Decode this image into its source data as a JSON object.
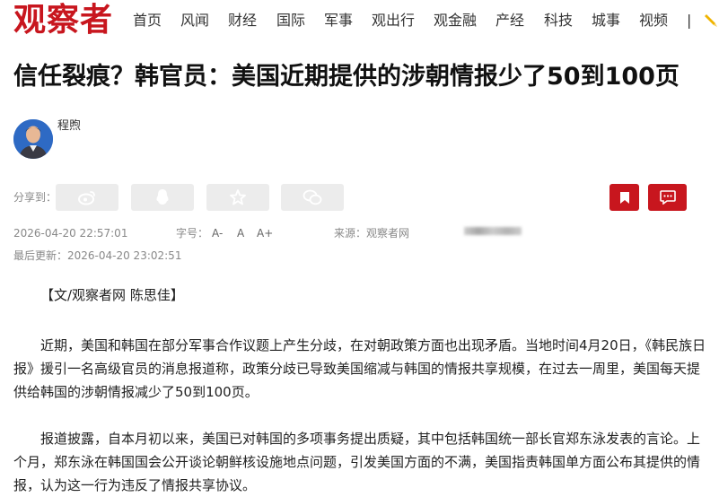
{
  "header": {
    "logo_text": "观察者",
    "nav": [
      "首页",
      "风闻",
      "财经",
      "国际",
      "军事",
      "观出行",
      "观金融",
      "产经",
      "科技",
      "城事",
      "视频"
    ],
    "separator": "|",
    "brand_color": "#c8161e"
  },
  "article": {
    "title": "信任裂痕？韩官员：美国近期提供的涉朝情报少了50到100页",
    "author": "程煦",
    "share_label": "分享到：",
    "share_icons": [
      "weibo-icon",
      "qq-icon",
      "star-icon",
      "wechat-icon"
    ],
    "publish_time": "2026-04-20 22:57:01",
    "font_size_label": "字号：",
    "font_sizes": [
      "A-",
      "A",
      "A+"
    ],
    "source_label": "来源：观察者网",
    "updated": "最后更新：2026-04-20 23:02:51",
    "byline": "【文/观察者网 陈思佳】",
    "paragraphs": [
      "近期，美国和韩国在部分军事合作议题上产生分歧，在对朝政策方面也出现矛盾。当地时间4月20日，《韩民族日报》援引一名高级官员的消息报道称，政策分歧已导致美国缩减与韩国的情报共享规模，在过去一周里，美国每天提供给韩国的涉朝情报减少了50到100页。",
      "报道披露，自本月初以来，美国已对韩国的多项事务提出质疑，其中包括韩国统一部长官郑东泳发表的言论。上个月，郑东泳在韩国国会公开谈论朝鲜核设施地点问题，引发美国方面的不满，美国指责韩国单方面公布其提供的情报，认为这一行为违反了情报共享协议。"
    ]
  }
}
